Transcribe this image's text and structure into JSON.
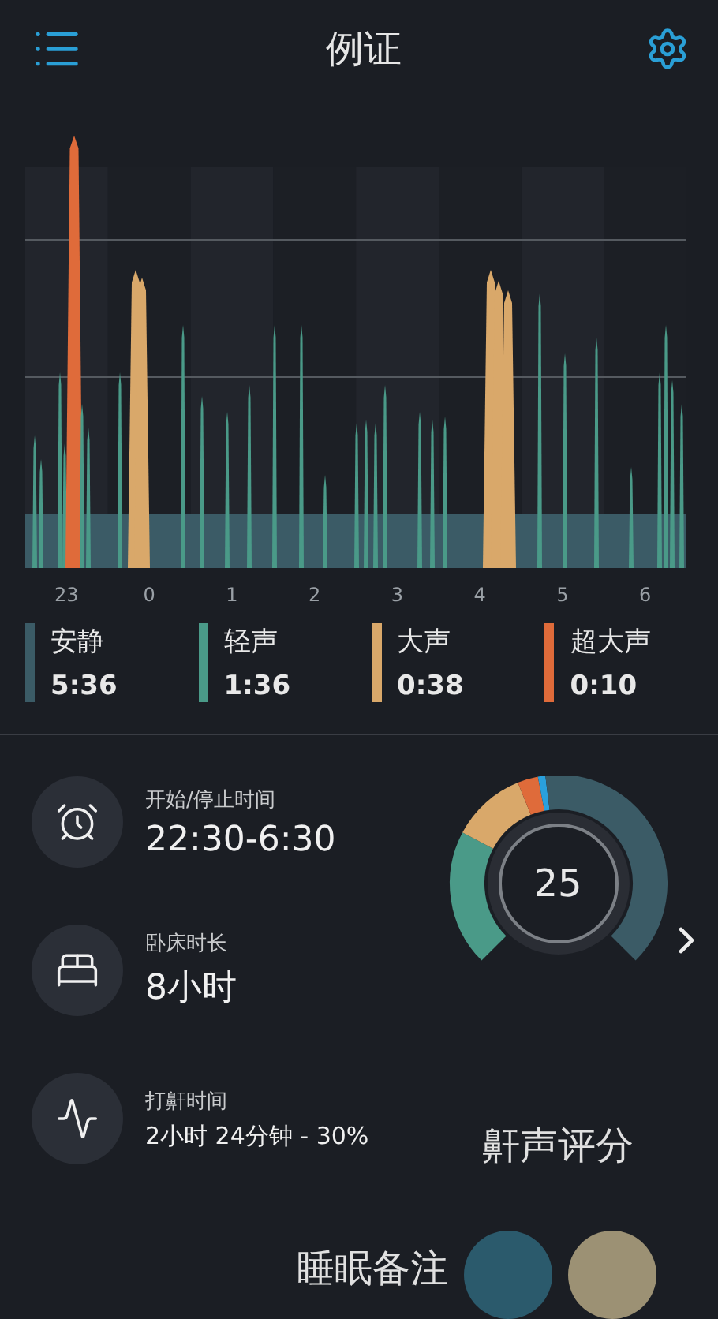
{
  "header": {
    "title": "例证"
  },
  "chart": {
    "x_labels": [
      "23",
      "0",
      "1",
      "2",
      "3",
      "4",
      "5",
      "6"
    ]
  },
  "legend": [
    {
      "label": "安静",
      "duration": "5:36",
      "color": "#3b5b66"
    },
    {
      "label": "轻声",
      "duration": "1:36",
      "color": "#4a9a88"
    },
    {
      "label": "大声",
      "duration": "0:38",
      "color": "#d9a86a"
    },
    {
      "label": "超大声",
      "duration": "0:10",
      "color": "#df6b3a"
    }
  ],
  "stats": [
    {
      "kind": "alarm",
      "label": "开始/停止时间",
      "value": "22:30-6:30"
    },
    {
      "kind": "bed",
      "label": "卧床时长",
      "value": "8小时"
    },
    {
      "kind": "wave",
      "label": "打鼾时间",
      "value": "2小时 24分钟 - 30%"
    }
  ],
  "score": {
    "value": "25",
    "label": "鼾声评分"
  },
  "notes": {
    "label": "睡眠备注"
  }
}
